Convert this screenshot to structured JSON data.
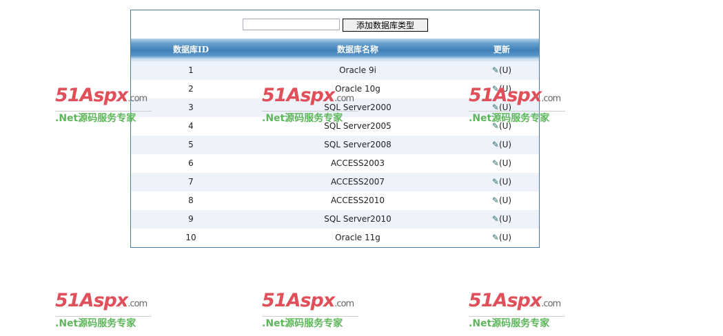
{
  "toolbar": {
    "input_value": "",
    "add_button": "添加数据库类型"
  },
  "table": {
    "headers": [
      "数据库ID",
      "数据库名称",
      "更新"
    ],
    "rows": [
      {
        "id": "1",
        "name": "Oracle 9i",
        "action": "(U)"
      },
      {
        "id": "2",
        "name": "Oracle 10g",
        "action": "(U)"
      },
      {
        "id": "3",
        "name": "SQL Server2000",
        "action": "(U)"
      },
      {
        "id": "4",
        "name": "SQL Server2005",
        "action": "(U)"
      },
      {
        "id": "5",
        "name": "SQL Server2008",
        "action": "(U)"
      },
      {
        "id": "6",
        "name": "ACCESS2003",
        "action": "(U)"
      },
      {
        "id": "7",
        "name": "ACCESS2007",
        "action": "(U)"
      },
      {
        "id": "8",
        "name": "ACCESS2010",
        "action": "(U)"
      },
      {
        "id": "9",
        "name": "SQL Server2010",
        "action": "(U)"
      },
      {
        "id": "10",
        "name": "Oracle 11g",
        "action": "(U)"
      }
    ]
  },
  "watermark": {
    "logo": "51Aspx",
    "domain": ".com",
    "slogan": ".Net源码服务专家"
  }
}
